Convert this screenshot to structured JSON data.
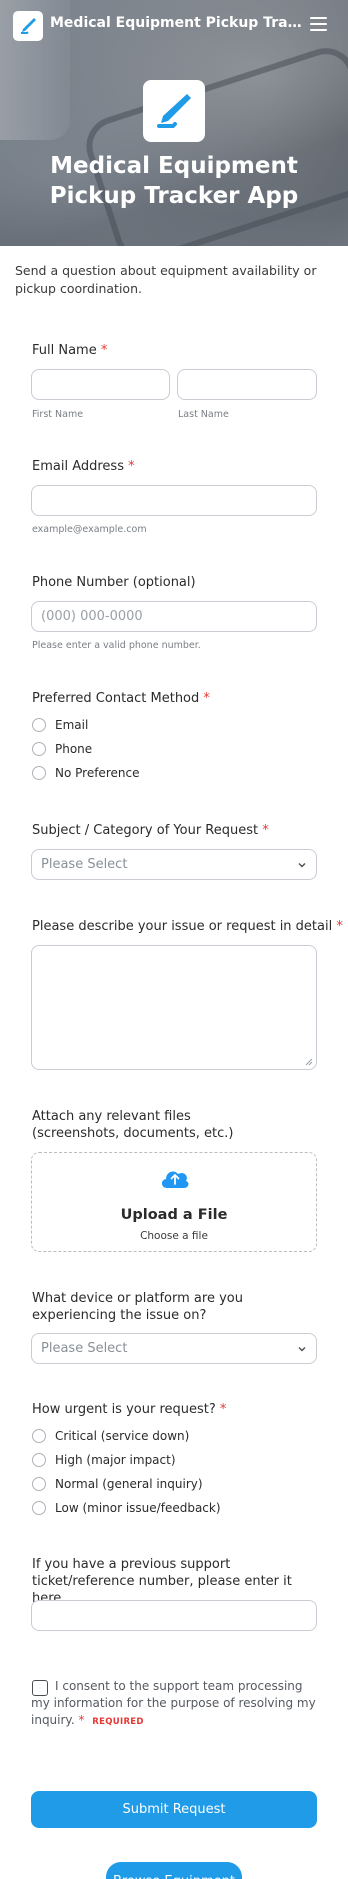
{
  "header": {
    "title": "Medical Equipment Pickup Tracker ...",
    "hero_title": "Medical Equipment Pickup Tracker App",
    "logo_icon": "syringe-pen-icon",
    "menu_icon": "hamburger-menu-icon"
  },
  "intro": "Send a question about equipment availability or pickup coordination.",
  "fields": {
    "full_name": {
      "label": "Full Name",
      "first_sub": "First Name",
      "last_sub": "Last Name"
    },
    "email": {
      "label": "Email Address",
      "sub": "example@example.com"
    },
    "phone": {
      "label": "Phone Number (optional)",
      "placeholder": "(000) 000-0000",
      "sub": "Please enter a valid phone number."
    },
    "contact_method": {
      "label": "Preferred Contact Method",
      "options": [
        "Email",
        "Phone",
        "No Preference"
      ]
    },
    "subject": {
      "label": "Subject / Category of Your Request",
      "placeholder": "Please Select"
    },
    "description": {
      "label": "Please describe your issue or request in detail"
    },
    "attach": {
      "label": "Attach any relevant files (screenshots, documents, etc.)",
      "upload_title": "Upload a File",
      "upload_sub": "Choose a file"
    },
    "device": {
      "label": "What device or platform are you experiencing the issue on?",
      "placeholder": "Please Select"
    },
    "urgency": {
      "label": "How urgent is your request?",
      "options": [
        "Critical (service down)",
        "High (major impact)",
        "Normal (general inquiry)",
        "Low (minor issue/feedback)"
      ]
    },
    "ticket": {
      "label": "If you have a previous support ticket/reference number, please enter it here"
    },
    "consent": {
      "text": "I consent to the support team processing my information for the purpose of resolving my inquiry.",
      "required_tag": "REQUIRED"
    }
  },
  "required_mark": "*",
  "buttons": {
    "submit": "Submit Request",
    "browse": "Browse Equipment"
  },
  "colors": {
    "accent": "#1f9be8",
    "required": "#e53935"
  }
}
